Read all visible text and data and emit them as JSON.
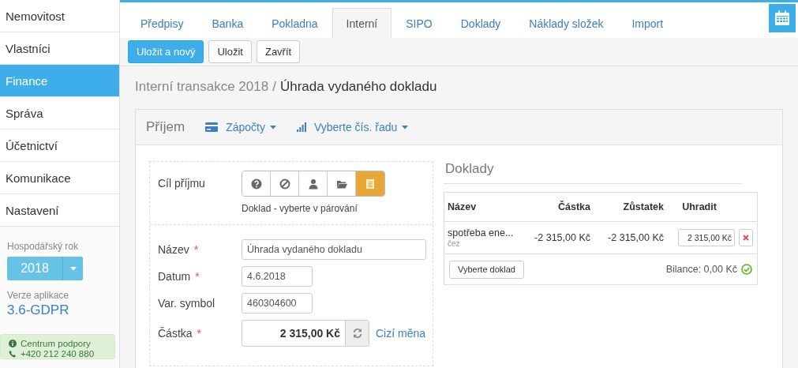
{
  "sidebar": {
    "items": [
      {
        "label": "Nemovitost",
        "selected": false
      },
      {
        "label": "Vlastníci",
        "selected": false
      },
      {
        "label": "Finance",
        "selected": true
      },
      {
        "label": "Správa",
        "selected": false
      },
      {
        "label": "Účetnictví",
        "selected": false
      },
      {
        "label": "Komunikace",
        "selected": false
      },
      {
        "label": "Nastavení",
        "selected": false
      }
    ],
    "fiscal_year": {
      "label": "Hospodářský rok",
      "value": "2018"
    },
    "version": {
      "label": "Verze aplikace",
      "value": "3.6-GDPR"
    },
    "support": {
      "title": "Centrum podpory",
      "phone": "+420 212 240 880"
    }
  },
  "tabs": [
    {
      "label": "Předpisy",
      "selected": false
    },
    {
      "label": "Banka",
      "selected": false
    },
    {
      "label": "Pokladna",
      "selected": false
    },
    {
      "label": "Interní",
      "selected": true
    },
    {
      "label": "SIPO",
      "selected": false
    },
    {
      "label": "Doklady",
      "selected": false
    },
    {
      "label": "Náklady složek",
      "selected": false
    },
    {
      "label": "Import",
      "selected": false
    }
  ],
  "toolbar": {
    "buttons": [
      {
        "label": "Uložit a nový",
        "kind": "primary"
      },
      {
        "label": "Uložit",
        "kind": "default"
      },
      {
        "label": "Zavřít",
        "kind": "default"
      }
    ]
  },
  "breadcrumb": {
    "parent": "Interní transakce 2018",
    "separator": "/",
    "current": "Úhrada vydaného dokladu"
  },
  "panel": {
    "title": "Příjem",
    "menus": [
      {
        "label": "Zápočty",
        "kind": "card"
      },
      {
        "label": "Vyberte čís. řadu",
        "kind": "bars"
      }
    ]
  },
  "target": {
    "label": "Cíl příjmu",
    "hint": "Doklad - vyberte v párování",
    "options": [
      {
        "kind": "question",
        "selected": false
      },
      {
        "kind": "ban",
        "selected": false
      },
      {
        "kind": "person",
        "selected": false
      },
      {
        "kind": "folder",
        "selected": false
      },
      {
        "kind": "document",
        "selected": true
      }
    ]
  },
  "fields": [
    {
      "label": "Název",
      "required_mark": "*",
      "value": "Úhrada vydaného dokladu",
      "kind": "wide"
    },
    {
      "label": "Datum",
      "required_mark": "*",
      "value": "4.6.2018",
      "kind": "short"
    },
    {
      "label": "Var. symbol",
      "value": "460304600",
      "kind": "short"
    },
    {
      "label": "Částka",
      "required_mark": "*",
      "value": "2 315,00 Kč",
      "kind": "amount",
      "link": "Cizí měna"
    }
  ],
  "doklady": {
    "title": "Doklady",
    "columns": [
      "Název",
      "Částka",
      "Zůstatek",
      "Uhradit"
    ],
    "rows": [
      {
        "name": "spotřeba ene...",
        "sub": "čez",
        "amount": "-2 315,00 Kč",
        "balance": "-2 315,00 Kč",
        "pay": "2 315,00 Kč"
      }
    ],
    "select_button": "Vyberte doklad",
    "balance": "Bilance: 0,00 Kč"
  }
}
